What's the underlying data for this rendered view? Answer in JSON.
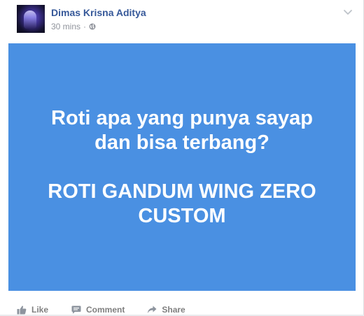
{
  "post": {
    "author_name": "Dimas Krisna Aditya",
    "timestamp": "30 mins",
    "separator": "·",
    "privacy_icon": "globe-icon",
    "options_icon": "chevron-down-icon"
  },
  "card": {
    "background_color": "#4a90e2",
    "text_color": "#ffffff",
    "question_line_1": "Roti apa yang punya sayap",
    "question_line_2": "dan bisa terbang?",
    "answer_line_1": "ROTI GANDUM WING ZERO",
    "answer_line_2": "CUSTOM"
  },
  "actions": {
    "like_label": "Like",
    "like_icon": "thumbs-up-icon",
    "comment_label": "Comment",
    "comment_icon": "comment-bubble-icon",
    "share_label": "Share",
    "share_icon": "share-arrow-icon"
  }
}
